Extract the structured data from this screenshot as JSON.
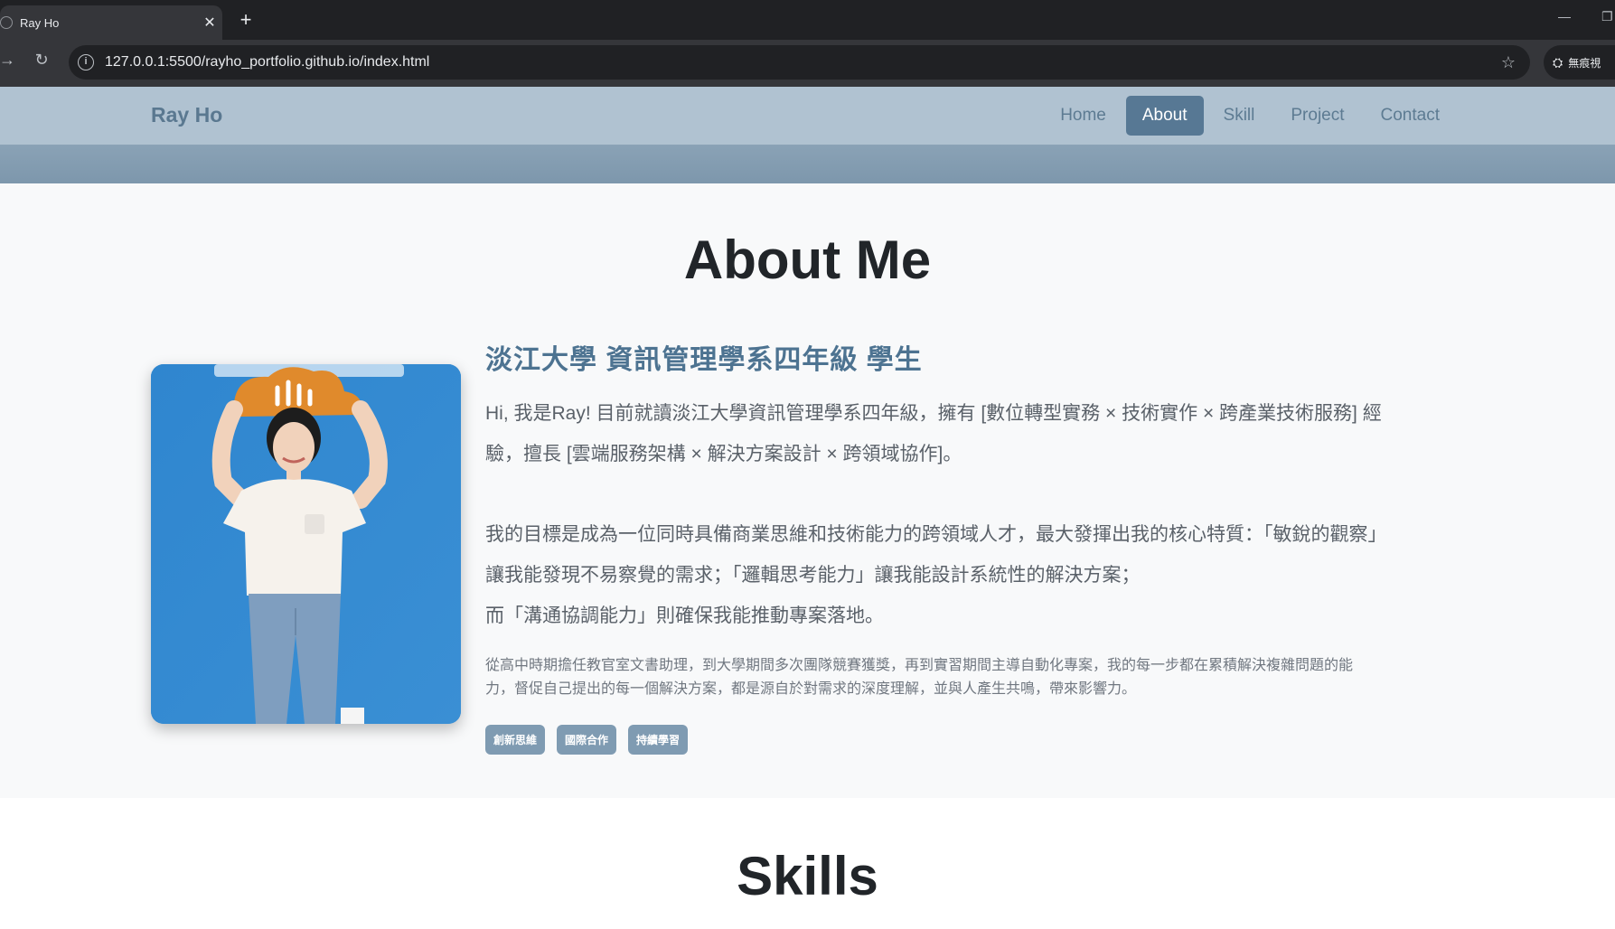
{
  "browser": {
    "tab_title": "Ray Ho",
    "tab_close": "✕",
    "new_tab": "+",
    "url": "127.0.0.1:5500/rayho_portfolio.github.io/index.html",
    "profile_label": "無痕視"
  },
  "nav": {
    "brand": "Ray Ho",
    "links": [
      "Home",
      "About",
      "Skill",
      "Project",
      "Contact"
    ],
    "active": "About"
  },
  "about": {
    "title": "About Me",
    "subtitle": "淡江大學 資訊管理學系四年級 學生",
    "intro_line1": "Hi, 我是Ray! 目前就讀淡江大學資訊管理學系四年級，擁有 [數位轉型實務 × 技術實作 × 跨產業技術服務] 經",
    "intro_line2": "驗，擅長 [雲端服務架構 × 解決方案設計 × 跨領域協作]。",
    "goal_line1": "我的目標是成為一位同時具備商業思維和技術能力的跨領域人才，最大發揮出我的核心特質：「敏銳的觀察」",
    "goal_line2": "讓我能發現不易察覺的需求；「邏輯思考能力」讓我能設計系統性的解決方案；",
    "goal_line3": "而「溝通協調能力」則確保我能推動專案落地。",
    "detail_line1": "從高中時期擔任教官室文書助理，到大學期間多次團隊競賽獲獎，再到實習期間主導自動化專案，我的每一步都在累積解決複雜問題的能",
    "detail_line2": "力，督促自己提出的每一個解決方案，都是源自於對需求的深度理解，並與人產生共鳴，帶來影響力。",
    "tags": [
      "創新思維",
      "國際合作",
      "持續學習"
    ]
  },
  "skills": {
    "title": "Skills"
  }
}
